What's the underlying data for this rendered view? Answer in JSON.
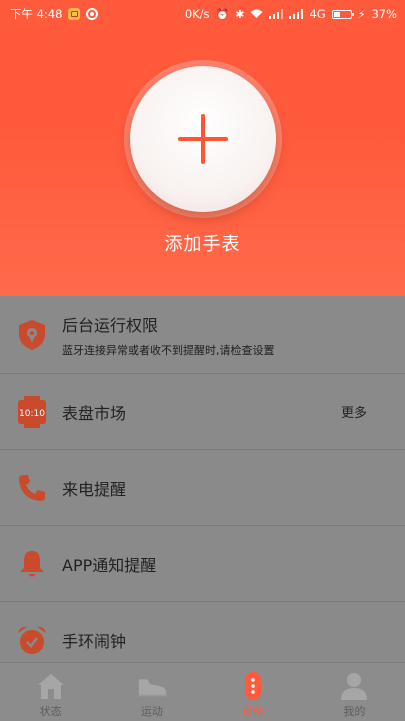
{
  "status_bar": {
    "time": "下午 4:48",
    "net_speed": "0K/s",
    "network": "4G",
    "battery": "37%"
  },
  "header": {
    "add_watch_label": "添加手表"
  },
  "list": [
    {
      "title": "后台运行权限",
      "subtitle": "蓝牙连接异常或者收不到提醒时,请检查设置",
      "icon": "shield-location-icon"
    },
    {
      "title": "表盘市场",
      "more": "更多",
      "icon": "watch-face-icon"
    },
    {
      "title": "来电提醒",
      "icon": "phone-icon"
    },
    {
      "title": "APP通知提醒",
      "icon": "bell-icon"
    },
    {
      "title": "手环闹钟",
      "icon": "alarm-clock-icon"
    }
  ],
  "watch_face_time": "10:10",
  "bottom_nav": [
    {
      "label": "状态",
      "icon": "home-icon"
    },
    {
      "label": "运动",
      "icon": "shoe-icon"
    },
    {
      "label": "设备",
      "icon": "band-icon",
      "active": true
    },
    {
      "label": "我的",
      "icon": "person-icon"
    }
  ],
  "colors": {
    "accent": "#ff5a3c",
    "overlay_gray": "#8a8a8a"
  }
}
